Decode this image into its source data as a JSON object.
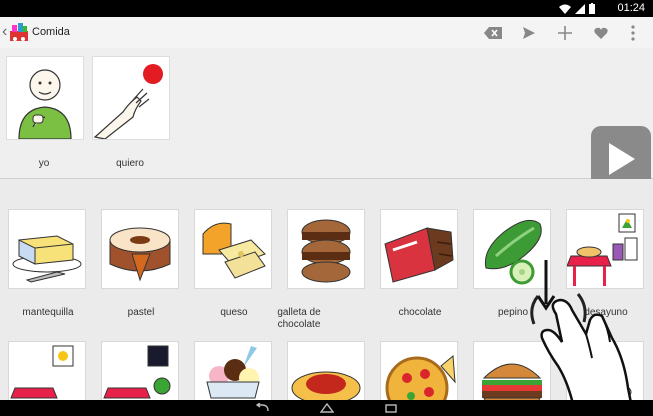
{
  "status": {
    "time": "01:24"
  },
  "app": {
    "title": "Comida"
  },
  "actions": [
    {
      "icon": "backspace-icon"
    },
    {
      "icon": "send-icon"
    },
    {
      "icon": "plus-icon"
    },
    {
      "icon": "heart-icon"
    },
    {
      "icon": "overflow-menu-icon"
    }
  ],
  "sentence": [
    {
      "label": "yo"
    },
    {
      "label": "quiero"
    }
  ],
  "tiles_row1": [
    {
      "label": "mantequilla"
    },
    {
      "label": "pastel"
    },
    {
      "label": "queso"
    },
    {
      "label": "galleta de chocolate"
    },
    {
      "label": "chocolate"
    },
    {
      "label": "pepino"
    },
    {
      "label": "desayuno"
    }
  ],
  "tiles_row2": [
    {
      "icon": "lunch-tray-icon"
    },
    {
      "icon": "dinner-tray-icon"
    },
    {
      "icon": "ice-cream-icon"
    },
    {
      "icon": "spaghetti-icon"
    },
    {
      "icon": "pizza-icon"
    },
    {
      "icon": "hamburger-icon"
    },
    {
      "icon": "food-icon"
    }
  ]
}
